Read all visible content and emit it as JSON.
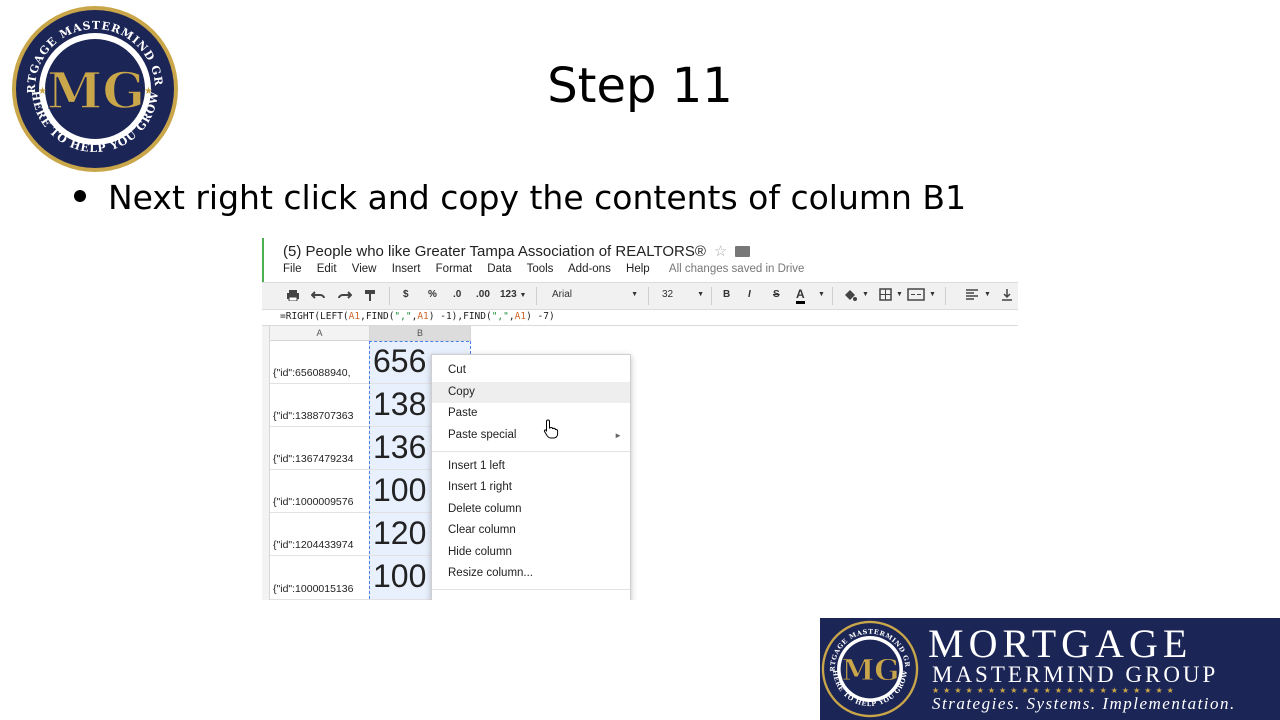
{
  "slide": {
    "title": "Step 11",
    "bullet": "Next right click and copy the contents of column B1"
  },
  "logo": {
    "monogram": "MG",
    "ring_top": "MORTGAGE MASTERMIND GROUP",
    "ring_bottom": "HERE TO HELP YOU GROW"
  },
  "sheet": {
    "title": "(5) People who like Greater Tampa Association of REALTORS®",
    "star": "☆",
    "menu": [
      "File",
      "Edit",
      "View",
      "Insert",
      "Format",
      "Data",
      "Tools",
      "Add-ons",
      "Help"
    ],
    "save_status": "All changes saved in Drive",
    "toolbar": {
      "currency": "$",
      "percent": "%",
      "dec_less": ".0",
      "dec_more": ".00",
      "number_format": "123",
      "font": "Arial",
      "font_size": "32",
      "bold": "B",
      "italic": "I",
      "strike": "S",
      "text_color": "A"
    },
    "formula": {
      "p1": "=RIGHT(LEFT(",
      "r1": "A1",
      "p2": ",FIND(",
      "l1": "\",\"",
      "p3": ",",
      "r2": "A1",
      "p4": ") -1),FIND(",
      "l2": "\",\"",
      "p5": ",",
      "r3": "A1",
      "p6": ") -7)"
    },
    "columns": [
      "A",
      "B"
    ],
    "rows": [
      {
        "a": "{\"id\":656088940,",
        "b": "656"
      },
      {
        "a": "{\"id\":1388707363",
        "b": "138"
      },
      {
        "a": "{\"id\":1367479234",
        "b": "136"
      },
      {
        "a": "{\"id\":1000009576",
        "b": "100"
      },
      {
        "a": "{\"id\":1204433974",
        "b": "120"
      },
      {
        "a": "{\"id\":1000015136",
        "b": "100"
      }
    ],
    "context_menu": {
      "group1": [
        "Cut",
        "Copy",
        "Paste",
        "Paste special"
      ],
      "group2": [
        "Insert 1 left",
        "Insert 1 right",
        "Delete column",
        "Clear column",
        "Hide column",
        "Resize column..."
      ],
      "highlighted": "Copy",
      "submenu_arrow": "►"
    }
  },
  "banner": {
    "line1": "MORTGAGE",
    "line2": "MASTERMIND GROUP",
    "stars": "★★★★★★★★★★★★★★★★★★★★★★",
    "tagline": "Strategies. Systems. Implementation."
  },
  "colors": {
    "navy": "#1b2556",
    "gold": "#c9a64a",
    "selection": "#e8f0fd",
    "selection_border": "#4a80e8"
  }
}
